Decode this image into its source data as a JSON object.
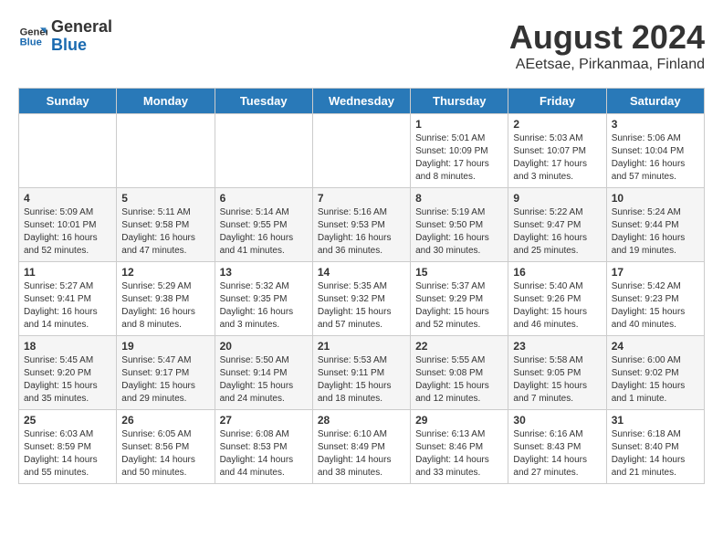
{
  "logo": {
    "line1": "General",
    "line2": "Blue"
  },
  "title": "August 2024",
  "subtitle": "AEetsae, Pirkanmaa, Finland",
  "weekdays": [
    "Sunday",
    "Monday",
    "Tuesday",
    "Wednesday",
    "Thursday",
    "Friday",
    "Saturday"
  ],
  "weeks": [
    [
      {
        "day": "",
        "sunrise": "",
        "sunset": "",
        "daylight": ""
      },
      {
        "day": "",
        "sunrise": "",
        "sunset": "",
        "daylight": ""
      },
      {
        "day": "",
        "sunrise": "",
        "sunset": "",
        "daylight": ""
      },
      {
        "day": "",
        "sunrise": "",
        "sunset": "",
        "daylight": ""
      },
      {
        "day": "1",
        "sunrise": "Sunrise: 5:01 AM",
        "sunset": "Sunset: 10:09 PM",
        "daylight": "Daylight: 17 hours and 8 minutes."
      },
      {
        "day": "2",
        "sunrise": "Sunrise: 5:03 AM",
        "sunset": "Sunset: 10:07 PM",
        "daylight": "Daylight: 17 hours and 3 minutes."
      },
      {
        "day": "3",
        "sunrise": "Sunrise: 5:06 AM",
        "sunset": "Sunset: 10:04 PM",
        "daylight": "Daylight: 16 hours and 57 minutes."
      }
    ],
    [
      {
        "day": "4",
        "sunrise": "Sunrise: 5:09 AM",
        "sunset": "Sunset: 10:01 PM",
        "daylight": "Daylight: 16 hours and 52 minutes."
      },
      {
        "day": "5",
        "sunrise": "Sunrise: 5:11 AM",
        "sunset": "Sunset: 9:58 PM",
        "daylight": "Daylight: 16 hours and 47 minutes."
      },
      {
        "day": "6",
        "sunrise": "Sunrise: 5:14 AM",
        "sunset": "Sunset: 9:55 PM",
        "daylight": "Daylight: 16 hours and 41 minutes."
      },
      {
        "day": "7",
        "sunrise": "Sunrise: 5:16 AM",
        "sunset": "Sunset: 9:53 PM",
        "daylight": "Daylight: 16 hours and 36 minutes."
      },
      {
        "day": "8",
        "sunrise": "Sunrise: 5:19 AM",
        "sunset": "Sunset: 9:50 PM",
        "daylight": "Daylight: 16 hours and 30 minutes."
      },
      {
        "day": "9",
        "sunrise": "Sunrise: 5:22 AM",
        "sunset": "Sunset: 9:47 PM",
        "daylight": "Daylight: 16 hours and 25 minutes."
      },
      {
        "day": "10",
        "sunrise": "Sunrise: 5:24 AM",
        "sunset": "Sunset: 9:44 PM",
        "daylight": "Daylight: 16 hours and 19 minutes."
      }
    ],
    [
      {
        "day": "11",
        "sunrise": "Sunrise: 5:27 AM",
        "sunset": "Sunset: 9:41 PM",
        "daylight": "Daylight: 16 hours and 14 minutes."
      },
      {
        "day": "12",
        "sunrise": "Sunrise: 5:29 AM",
        "sunset": "Sunset: 9:38 PM",
        "daylight": "Daylight: 16 hours and 8 minutes."
      },
      {
        "day": "13",
        "sunrise": "Sunrise: 5:32 AM",
        "sunset": "Sunset: 9:35 PM",
        "daylight": "Daylight: 16 hours and 3 minutes."
      },
      {
        "day": "14",
        "sunrise": "Sunrise: 5:35 AM",
        "sunset": "Sunset: 9:32 PM",
        "daylight": "Daylight: 15 hours and 57 minutes."
      },
      {
        "day": "15",
        "sunrise": "Sunrise: 5:37 AM",
        "sunset": "Sunset: 9:29 PM",
        "daylight": "Daylight: 15 hours and 52 minutes."
      },
      {
        "day": "16",
        "sunrise": "Sunrise: 5:40 AM",
        "sunset": "Sunset: 9:26 PM",
        "daylight": "Daylight: 15 hours and 46 minutes."
      },
      {
        "day": "17",
        "sunrise": "Sunrise: 5:42 AM",
        "sunset": "Sunset: 9:23 PM",
        "daylight": "Daylight: 15 hours and 40 minutes."
      }
    ],
    [
      {
        "day": "18",
        "sunrise": "Sunrise: 5:45 AM",
        "sunset": "Sunset: 9:20 PM",
        "daylight": "Daylight: 15 hours and 35 minutes."
      },
      {
        "day": "19",
        "sunrise": "Sunrise: 5:47 AM",
        "sunset": "Sunset: 9:17 PM",
        "daylight": "Daylight: 15 hours and 29 minutes."
      },
      {
        "day": "20",
        "sunrise": "Sunrise: 5:50 AM",
        "sunset": "Sunset: 9:14 PM",
        "daylight": "Daylight: 15 hours and 24 minutes."
      },
      {
        "day": "21",
        "sunrise": "Sunrise: 5:53 AM",
        "sunset": "Sunset: 9:11 PM",
        "daylight": "Daylight: 15 hours and 18 minutes."
      },
      {
        "day": "22",
        "sunrise": "Sunrise: 5:55 AM",
        "sunset": "Sunset: 9:08 PM",
        "daylight": "Daylight: 15 hours and 12 minutes."
      },
      {
        "day": "23",
        "sunrise": "Sunrise: 5:58 AM",
        "sunset": "Sunset: 9:05 PM",
        "daylight": "Daylight: 15 hours and 7 minutes."
      },
      {
        "day": "24",
        "sunrise": "Sunrise: 6:00 AM",
        "sunset": "Sunset: 9:02 PM",
        "daylight": "Daylight: 15 hours and 1 minute."
      }
    ],
    [
      {
        "day": "25",
        "sunrise": "Sunrise: 6:03 AM",
        "sunset": "Sunset: 8:59 PM",
        "daylight": "Daylight: 14 hours and 55 minutes."
      },
      {
        "day": "26",
        "sunrise": "Sunrise: 6:05 AM",
        "sunset": "Sunset: 8:56 PM",
        "daylight": "Daylight: 14 hours and 50 minutes."
      },
      {
        "day": "27",
        "sunrise": "Sunrise: 6:08 AM",
        "sunset": "Sunset: 8:53 PM",
        "daylight": "Daylight: 14 hours and 44 minutes."
      },
      {
        "day": "28",
        "sunrise": "Sunrise: 6:10 AM",
        "sunset": "Sunset: 8:49 PM",
        "daylight": "Daylight: 14 hours and 38 minutes."
      },
      {
        "day": "29",
        "sunrise": "Sunrise: 6:13 AM",
        "sunset": "Sunset: 8:46 PM",
        "daylight": "Daylight: 14 hours and 33 minutes."
      },
      {
        "day": "30",
        "sunrise": "Sunrise: 6:16 AM",
        "sunset": "Sunset: 8:43 PM",
        "daylight": "Daylight: 14 hours and 27 minutes."
      },
      {
        "day": "31",
        "sunrise": "Sunrise: 6:18 AM",
        "sunset": "Sunset: 8:40 PM",
        "daylight": "Daylight: 14 hours and 21 minutes."
      }
    ]
  ]
}
